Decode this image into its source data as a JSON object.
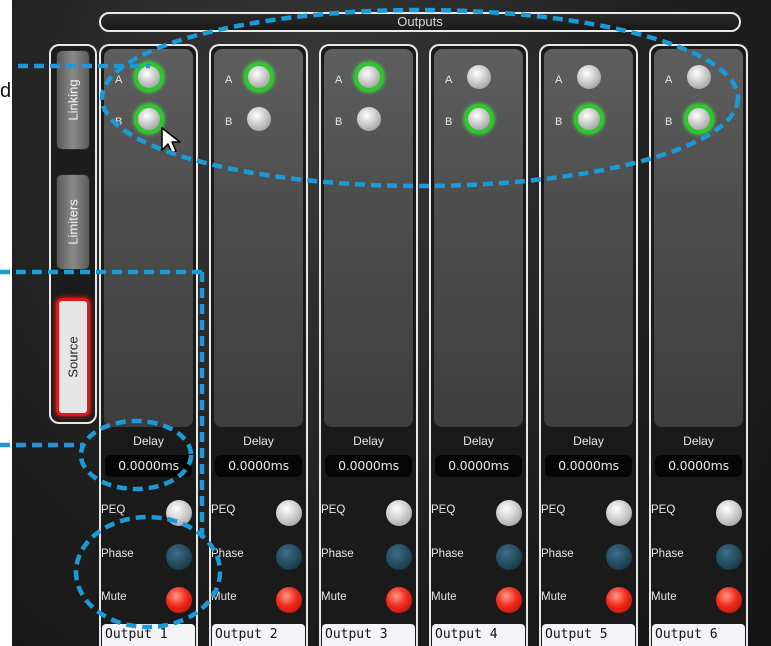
{
  "page": {
    "left_snippet": "d"
  },
  "header": {
    "title": "Outputs"
  },
  "side_tabs": [
    {
      "label": "Linking",
      "active": false
    },
    {
      "label": "Limiters",
      "active": false
    },
    {
      "label": "Source",
      "active": true
    }
  ],
  "channels": [
    {
      "name": "Output 1",
      "a_label": "A",
      "b_label": "B",
      "a_on": true,
      "b_on": true,
      "delay_label": "Delay",
      "delay": "0.0000ms",
      "peq": "PEQ",
      "phase": "Phase",
      "mute": "Mute"
    },
    {
      "name": "Output 2",
      "a_label": "A",
      "b_label": "B",
      "a_on": true,
      "b_on": false,
      "delay_label": "Delay",
      "delay": "0.0000ms",
      "peq": "PEQ",
      "phase": "Phase",
      "mute": "Mute"
    },
    {
      "name": "Output 3",
      "a_label": "A",
      "b_label": "B",
      "a_on": true,
      "b_on": false,
      "delay_label": "Delay",
      "delay": "0.0000ms",
      "peq": "PEQ",
      "phase": "Phase",
      "mute": "Mute"
    },
    {
      "name": "Output 4",
      "a_label": "A",
      "b_label": "B",
      "a_on": false,
      "b_on": true,
      "delay_label": "Delay",
      "delay": "0.0000ms",
      "peq": "PEQ",
      "phase": "Phase",
      "mute": "Mute"
    },
    {
      "name": "Output 5",
      "a_label": "A",
      "b_label": "B",
      "a_on": false,
      "b_on": true,
      "delay_label": "Delay",
      "delay": "0.0000ms",
      "peq": "PEQ",
      "phase": "Phase",
      "mute": "Mute"
    },
    {
      "name": "Output 6",
      "a_label": "A",
      "b_label": "B",
      "a_on": false,
      "b_on": true,
      "delay_label": "Delay",
      "delay": "0.0000ms",
      "peq": "PEQ",
      "phase": "Phase",
      "mute": "Mute"
    }
  ],
  "colors": {
    "accent_green": "#2ec82e",
    "mute_red": "#f02a1a",
    "annotation_blue": "#1a9ad6"
  }
}
